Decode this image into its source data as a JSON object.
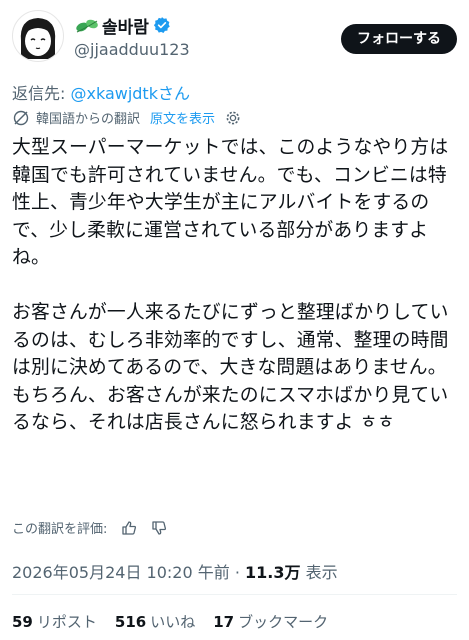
{
  "author": {
    "display_name": "솔바람",
    "handle": "@jjaadduu123",
    "avatar_icon": "cartoon-face-avatar",
    "name_icon": "green-leaf-icon",
    "badge_icon": "verified-badge-icon",
    "badge_color": "#1d9bf0"
  },
  "follow_button": {
    "label": "フォローする"
  },
  "reply": {
    "prefix": "返信先: ",
    "mention": "@xkawjdtkさん"
  },
  "translation": {
    "from_label": "韓国語からの翻訳",
    "show_original_label": "原文を表示",
    "translate_icon": "translate-icon",
    "settings_icon": "gear-icon"
  },
  "post": {
    "body": "大型スーパーマーケットでは、このようなやり方は韓国でも許可されていません。でも、コンビニは特性上、青少年や大学生が主にアルバイトをするので、少し柔軟に運営されている部分がありますよね。\n\nお客さんが一人来るたびにずっと整理ばかりしているのは、むしろ非効率的ですし、通常、整理の時間は別に決めてあるので、大きな問題はありません。もちろん、お客さんが来たのにスマホばかり見ているなら、それは店長さんに怒られますよ ㅎㅎ"
  },
  "rating": {
    "label": "この翻訳を評価:",
    "thumbs_up_icon": "thumbs-up-icon",
    "thumbs_down_icon": "thumbs-down-icon"
  },
  "meta": {
    "timestamp": "2026年05月24日 10:20 午前",
    "separator": " · ",
    "views_count": "11.3万",
    "views_label": " 表示"
  },
  "stats": [
    {
      "count": "59",
      "label": "リポスト"
    },
    {
      "count": "516",
      "label": "いいね"
    },
    {
      "count": "17",
      "label": "ブックマーク"
    }
  ],
  "colors": {
    "accent": "#1d9bf0",
    "text": "#0f1419",
    "secondary": "#536471",
    "button_bg": "#0f1419"
  }
}
